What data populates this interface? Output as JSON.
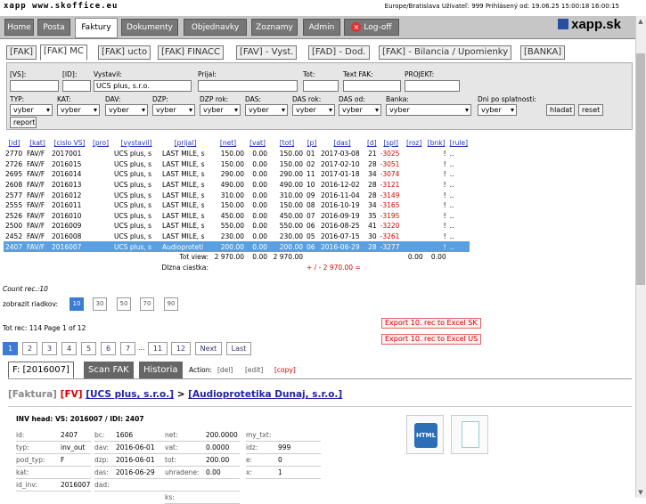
{
  "topbar": {
    "brand": "xapp www.skoffice.eu",
    "session": "Europe/Bratislava Užívateľ: 999 Prihlásený od: 19.06.25 15:00:18  16:00:15"
  },
  "nav": {
    "items": [
      "Home",
      "Posta",
      "Faktury",
      "Dokumenty",
      "Objednavky",
      "Zoznamy",
      "Admin",
      "Log-off"
    ],
    "active": "Faktury",
    "logo": "xapp.sk"
  },
  "subtabs": [
    "[FAK]",
    "[FAK] MC",
    "[FAK] ucto",
    "[FAK] FINACC",
    "[FAV] - Vyst.",
    "[FAD] - Dod.",
    "[FAK] - Bilancia / Upomienky",
    "[BANKA]"
  ],
  "filters": {
    "row1_labels": [
      "[VS]:",
      "[ID]:",
      "Vystavil:",
      "Prijal:",
      "Tot:",
      "Text FAK:",
      "PROJEKT:"
    ],
    "vystavil_value": "UCS plus, s.r.o.",
    "row2_labels": [
      "TYP:",
      "KAT:",
      "DAV:",
      "DZP:",
      "DZP rok:",
      "DAS:",
      "DAS rok:",
      "DAS od:",
      "Banka:",
      "Dni po splatnosti:"
    ],
    "select_value": "vyber",
    "buttons": {
      "hladat": "hladat",
      "reset": "reset",
      "report": "report"
    }
  },
  "table": {
    "headers": [
      "[id]",
      "[kat]",
      "[cislo VS]",
      "[pro]",
      "[vystavil]",
      "[prijal]",
      "[net]",
      "[vat]",
      "[tot]",
      "[p]",
      "[das]",
      "[d]",
      "[spl]",
      "[roz]",
      "[bnk]",
      "[rule]"
    ],
    "rows": [
      [
        "2770",
        "FAV/F",
        "2017001",
        "",
        "UCS plus, s",
        "LAST MILE, s",
        "150.00",
        "0.00",
        "150.00",
        "01",
        "2017-03-08",
        "21",
        "-3025",
        "",
        "!",
        ".."
      ],
      [
        "2726",
        "FAV/F",
        "2016015",
        "",
        "UCS plus, s",
        "LAST MILE, s",
        "150.00",
        "0.00",
        "150.00",
        "02",
        "2017-02-10",
        "28",
        "-3051",
        "",
        "!",
        ".."
      ],
      [
        "2695",
        "FAV/F",
        "2016014",
        "",
        "UCS plus, s",
        "LAST MILE, s",
        "290.00",
        "0.00",
        "290.00",
        "11",
        "2017-01-18",
        "34",
        "-3074",
        "",
        "!",
        ".."
      ],
      [
        "2608",
        "FAV/F",
        "2016013",
        "",
        "UCS plus, s",
        "LAST MILE, s",
        "490.00",
        "0.00",
        "490.00",
        "10",
        "2016-12-02",
        "28",
        "-3121",
        "",
        "!",
        ".."
      ],
      [
        "2577",
        "FAV/F",
        "2016012",
        "",
        "UCS plus, s",
        "LAST MILE, s",
        "310.00",
        "0.00",
        "310.00",
        "09",
        "2016-11-04",
        "28",
        "-3149",
        "",
        "!",
        ".."
      ],
      [
        "2555",
        "FAV/F",
        "2016011",
        "",
        "UCS plus, s",
        "LAST MILE, s",
        "150.00",
        "0.00",
        "150.00",
        "08",
        "2016-10-19",
        "34",
        "-3165",
        "",
        "!",
        ".."
      ],
      [
        "2526",
        "FAV/F",
        "2016010",
        "",
        "UCS plus, s",
        "LAST MILE, s",
        "450.00",
        "0.00",
        "450.00",
        "07",
        "2016-09-19",
        "35",
        "-3195",
        "",
        "!",
        ".."
      ],
      [
        "2500",
        "FAV/F",
        "2016009",
        "",
        "UCS plus, s",
        "LAST MILE, s",
        "550.00",
        "0.00",
        "550.00",
        "06",
        "2016-08-25",
        "41",
        "-3220",
        "",
        "!",
        ".."
      ],
      [
        "2452",
        "FAV/F",
        "2016008",
        "",
        "UCS plus, s",
        "LAST MILE, s",
        "230.00",
        "0.00",
        "230.00",
        "05",
        "2016-07-15",
        "30",
        "-3261",
        "",
        "!",
        ".."
      ],
      [
        "2407",
        "FAV/F",
        "2016007",
        "",
        "UCS plus, s",
        "Audioproteti",
        "200.00",
        "0.00",
        "200.00",
        "06",
        "2016-06-29",
        "28",
        "-3277",
        "",
        "!",
        ".."
      ]
    ],
    "tot_view_label": "Tot view:",
    "tot_view": [
      "2 970.00",
      "0.00",
      "2 970.00"
    ],
    "tot_right": [
      "0.00",
      "0.00"
    ],
    "dlzna_label": "Dlzna ciastka:",
    "dlzna_value": "+ / - 2 970.00 ="
  },
  "count_rec": "Count rec.:10",
  "rows_per_page": {
    "label": "zobrazit riadkov:",
    "options": [
      "10",
      "30",
      "50",
      "70",
      "90"
    ],
    "active": "10"
  },
  "totals": "Tot rec:  114   Page 1 of 12",
  "export": {
    "sk": "Export 10. rec to Excel SK",
    "us": "Export 10. rec to Excel US"
  },
  "pagination": [
    "1",
    "2",
    "3",
    "4",
    "5",
    "6",
    "7",
    "...",
    "11",
    "12",
    "Next",
    "Last"
  ],
  "detail_tabs": {
    "f": "F: [2016007]",
    "scan": "Scan FAK",
    "historia": "Historia",
    "action_label": "Action:",
    "del": "[del]",
    "edit": "[edit]",
    "copy": "[copy]"
  },
  "path": {
    "faktura": "[Faktura]",
    "fv": "[FV]",
    "from": "[UCS plus, s.r.o.]",
    "arrow": ">",
    "to": "[Audioprotetika Dunaj, s.r.o.]"
  },
  "detail": {
    "head": "INV head: VS: 2016007 / IDI: 2407",
    "col1": [
      [
        "id:",
        "2407"
      ],
      [
        "typ:",
        "inv_out"
      ],
      [
        "pod_typ:",
        "F"
      ],
      [
        "kat:",
        ""
      ],
      [
        "id_inv:",
        "2016007"
      ]
    ],
    "col2": [
      [
        "bc:",
        "1606"
      ],
      [
        "dav:",
        "2016-06-01"
      ],
      [
        "dzp:",
        "2016-06-01"
      ],
      [
        "das:",
        "2016-06-29"
      ],
      [
        "dad:",
        ""
      ]
    ],
    "col3": [
      [
        "net:",
        "200.0000"
      ],
      [
        "vat:",
        "0.0000"
      ],
      [
        "tot:",
        "200.00"
      ],
      [
        "uhradene:",
        "0.00"
      ],
      [
        "",
        ""
      ],
      [
        "ks:",
        ""
      ]
    ],
    "col4": [
      [
        "my_txt:",
        ""
      ],
      [
        "idz:",
        "999"
      ],
      [
        "e:",
        "0"
      ],
      [
        "x:",
        "1"
      ]
    ]
  }
}
